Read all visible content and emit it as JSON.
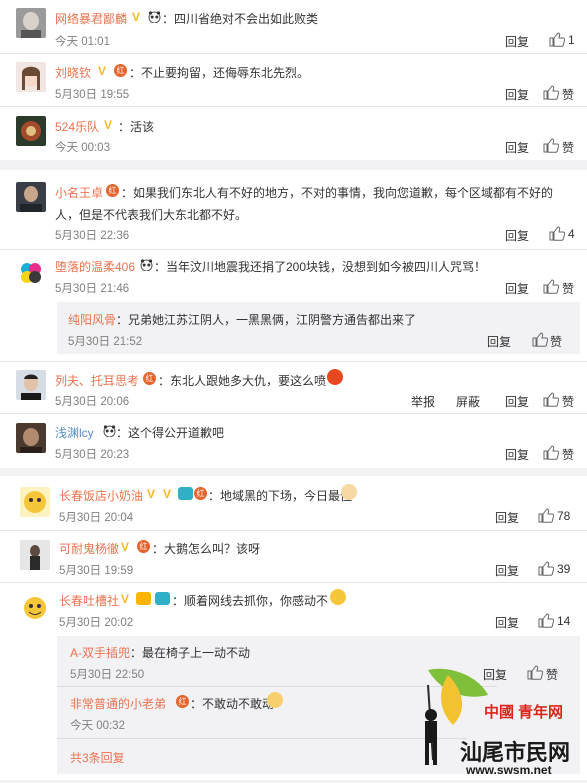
{
  "comments": [
    {
      "user": "网络暴君鄙麟",
      "text": "：四川省绝对不会出如此败类",
      "time": "今天 01:01",
      "reply": "回复",
      "likes": "1"
    },
    {
      "user": "刘晓钦",
      "text": "：不止要拘留，还侮辱东北先烈。",
      "time": "5月30日 19:55",
      "reply": "回复",
      "likes": "赞"
    },
    {
      "user": "524乐队",
      "text": "：活该",
      "time": "今天 00:03",
      "reply": "回复",
      "likes": "赞"
    },
    {
      "user": "小名王卓",
      "text1": "：如果我们东北人有不好的地方，不对的事情，我向您道歉，每个区域都有不好的",
      "text2": "人，但是不代表我们大东北都不好。",
      "time": "5月30日 22:36",
      "reply": "回复",
      "likes": "4"
    },
    {
      "user": "堕落的温柔406",
      "text": "：当年汶川地震我还捐了200块钱，没想到如今被四川人咒骂！",
      "time": "5月30日 21:46",
      "reply": "回复",
      "likes": "赞",
      "sub": {
        "user": "纯阳风骨",
        "text": "：兄弟她江苏江阴人，一黑黑俩，江阴警方通告都出来了",
        "time": "5月30日 21:52",
        "reply": "回复",
        "likes": "赞"
      }
    },
    {
      "user": "列夫、托耳思考",
      "text": "：东北人跟她多大仇，要这么喷",
      "time": "5月30日 20:06",
      "report": "举报",
      "block": "屏蔽",
      "reply": "回复",
      "likes": "赞"
    },
    {
      "user": "浅渊lcy",
      "text": "：这个得公开道歉吧",
      "time": "5月30日 20:23",
      "reply": "回复",
      "likes": "赞"
    },
    {
      "user": "长春饭店小奶油",
      "text": "：地域黑的下场，今日最佳",
      "time": "5月30日 20:04",
      "reply": "回复",
      "likes": "78"
    },
    {
      "user": "可耐鬼杨徹",
      "text": "：大鹅怎么叫？该呀",
      "time": "5月30日 19:59",
      "reply": "回复",
      "likes": "39"
    },
    {
      "user": "长春吐槽社",
      "text": "：顺着网线去抓你，你感动不",
      "time": "5月30日 20:02",
      "reply": "回复",
      "likes": "14",
      "subs": [
        {
          "user": "A-双手插兜",
          "text": "：最在椅子上一动不动",
          "time": "5月30日 22:50",
          "reply": "回复",
          "likes": "赞"
        },
        {
          "user": "非常普通的小老弟",
          "text": "：不敢动不敢动",
          "time": "今天 00:32"
        }
      ],
      "more": "共3条回复"
    }
  ],
  "watermark": {
    "line1": "中國",
    "line2": "青年网",
    "line3": "汕尾市民网",
    "url": "www.swsm.net"
  },
  "colors": {
    "name": "#eb7350",
    "name_blue": "#5a8fc6",
    "time": "#808080",
    "bg": "#f2f2f5"
  }
}
